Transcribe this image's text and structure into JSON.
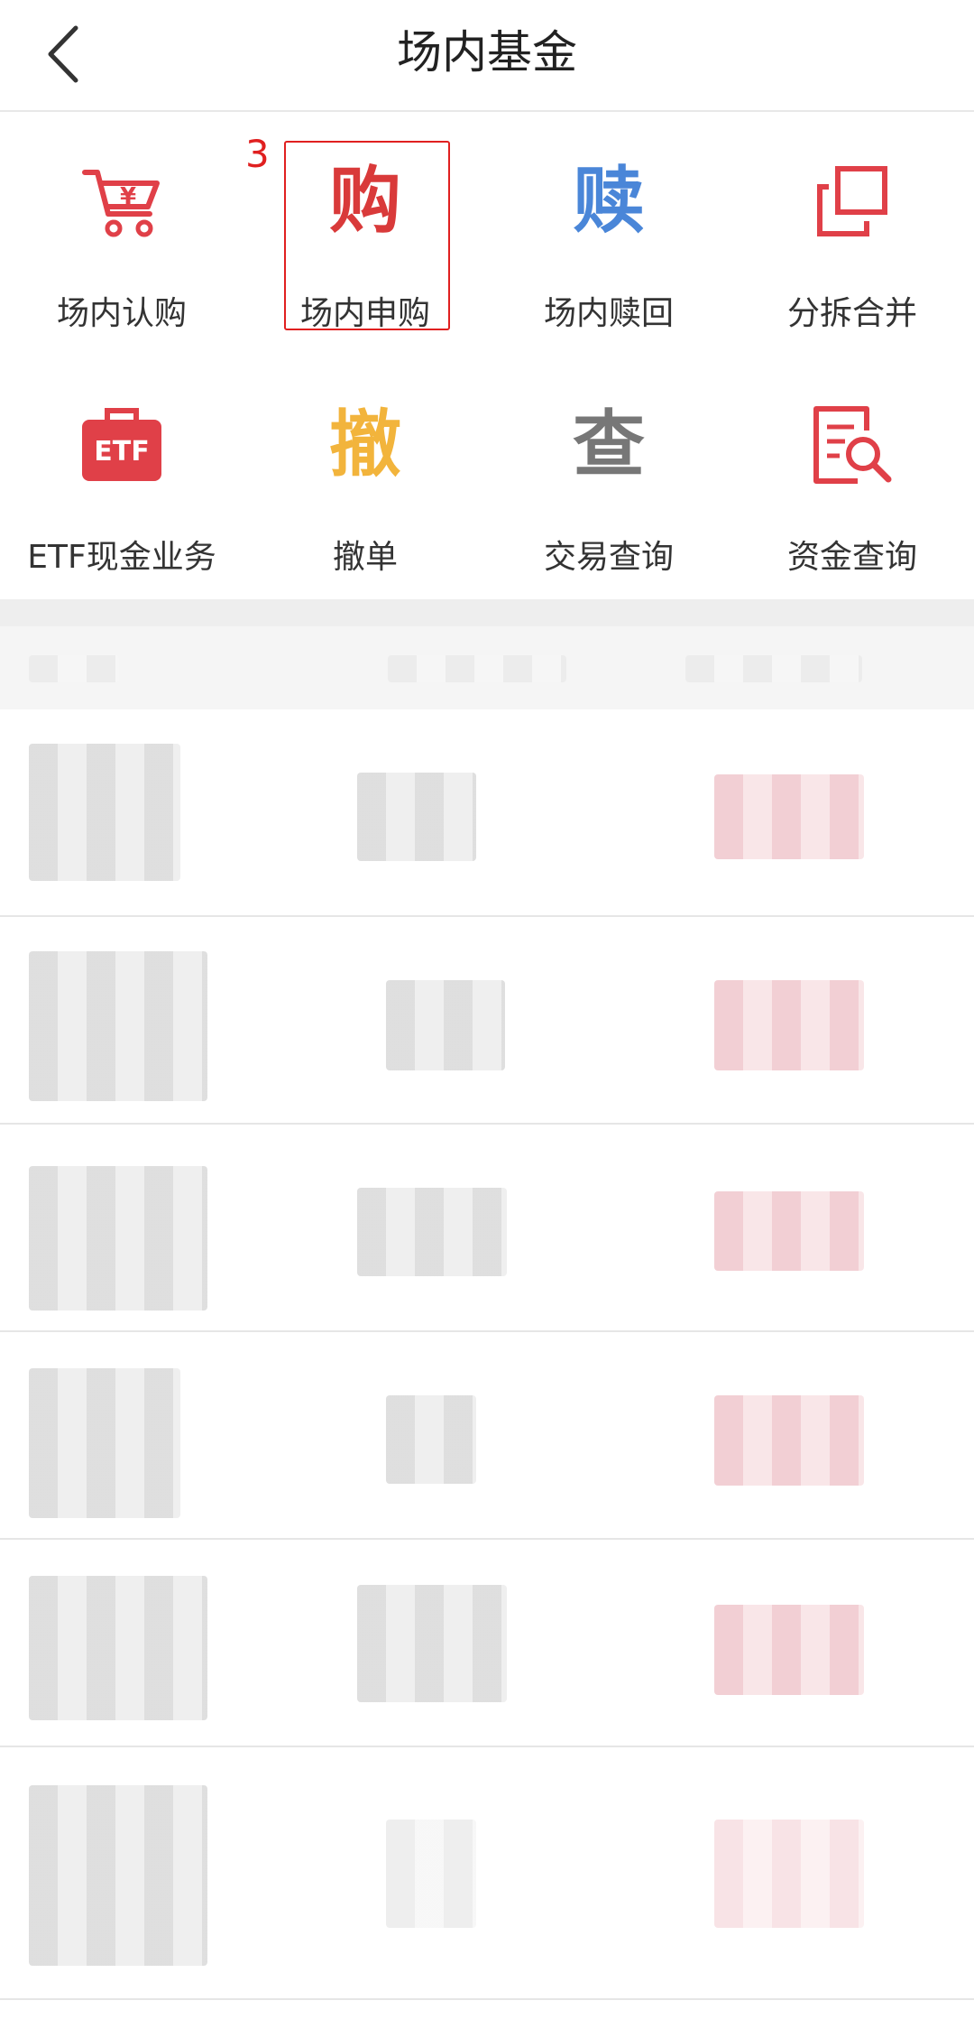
{
  "header": {
    "title": "场内基金",
    "back_icon": "chevron-left-icon"
  },
  "annotation": {
    "marker": "3"
  },
  "menu": [
    {
      "label": "场内认购",
      "icon": "shopping-cart-yen-icon",
      "color": "#e04048"
    },
    {
      "label": "场内申购",
      "icon": "gou-character-icon",
      "color": "#d93a3a",
      "glyph": "购"
    },
    {
      "label": "场内赎回",
      "icon": "shu-character-icon",
      "color": "#4a86d8",
      "glyph": "赎"
    },
    {
      "label": "分拆合并",
      "icon": "split-merge-icon",
      "color": "#e04048"
    },
    {
      "label": "ETF现金业务",
      "icon": "etf-briefcase-icon",
      "color": "#e04048"
    },
    {
      "label": "撤单",
      "icon": "che-character-icon",
      "color": "#f2b43c",
      "glyph": "撤"
    },
    {
      "label": "交易查询",
      "icon": "cha-character-icon",
      "color": "#777777",
      "glyph": "查"
    },
    {
      "label": "资金查询",
      "icon": "document-search-icon",
      "color": "#e04048"
    }
  ],
  "colors": {
    "accent_red": "#e02020",
    "divider": "#e6e6e6"
  }
}
